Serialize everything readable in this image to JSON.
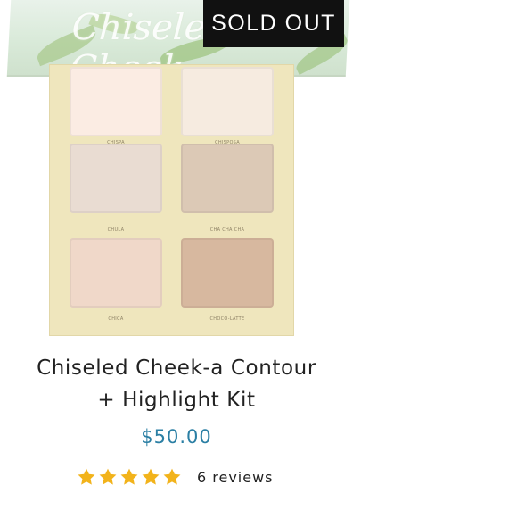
{
  "badge": {
    "label": "SOLD OUT"
  },
  "product": {
    "title_line1": "Chiseled Cheek-a Contour",
    "title_line2": "+ Highlight Kit",
    "price": "$50.00",
    "rating": {
      "stars": 5,
      "max": 5,
      "reviews_label": "6 reviews"
    }
  },
  "palette": {
    "lid_script": "Chiseled Cheek",
    "shades": [
      {
        "name": "CHISPA",
        "color": "#fbece3"
      },
      {
        "name": "CHISPOSA",
        "color": "#f6ebe0"
      },
      {
        "name": "CHULA",
        "color": "#e9dcd2"
      },
      {
        "name": "CHA CHA CHA",
        "color": "#dcc9b6"
      },
      {
        "name": "CHICA",
        "color": "#f0d8c9"
      },
      {
        "name": "CHOCO-LATTE",
        "color": "#d7b89f"
      }
    ]
  },
  "colors": {
    "price": "#2b7fa4",
    "star": "#f2b31b",
    "badge": "#111111"
  }
}
